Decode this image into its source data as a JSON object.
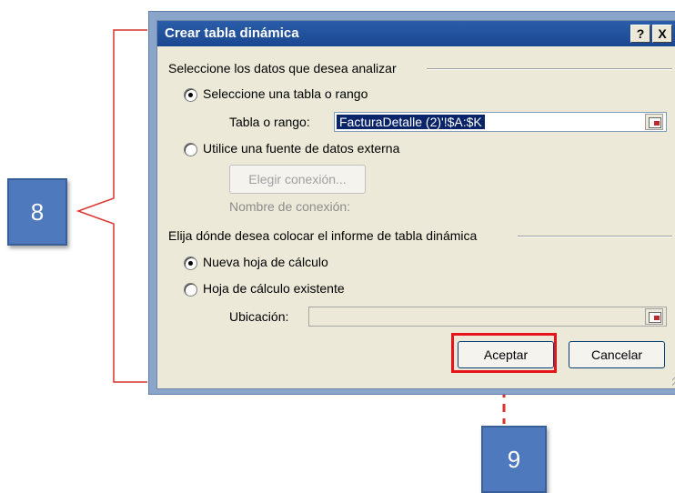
{
  "dialog": {
    "title": "Crear tabla dinámica",
    "help_button": "?",
    "close_button": "X",
    "section1_title": "Seleccione los datos que desea analizar",
    "radio_table_label": "Seleccione una tabla o rango",
    "table_range_label": "Tabla o rango:",
    "table_range_value": "FacturaDetalle (2)'!$A:$K",
    "radio_external_label": "Utilice una fuente de datos externa",
    "choose_connection_button": "Elegir conexión...",
    "connection_name_label": "Nombre de conexión:",
    "section2_title": "Elija dónde desea colocar el informe de tabla dinámica",
    "radio_new_sheet_label": "Nueva hoja de cálculo",
    "radio_existing_sheet_label": "Hoja de cálculo existente",
    "location_label": "Ubicación:",
    "location_value": "",
    "ok_button": "Aceptar",
    "cancel_button": "Cancelar"
  },
  "annotations": {
    "callout_8": "8",
    "callout_9": "9",
    "bracket_color": "#d9342b",
    "highlight_color": "#e8141b",
    "callout_color": "#4f79bd"
  }
}
